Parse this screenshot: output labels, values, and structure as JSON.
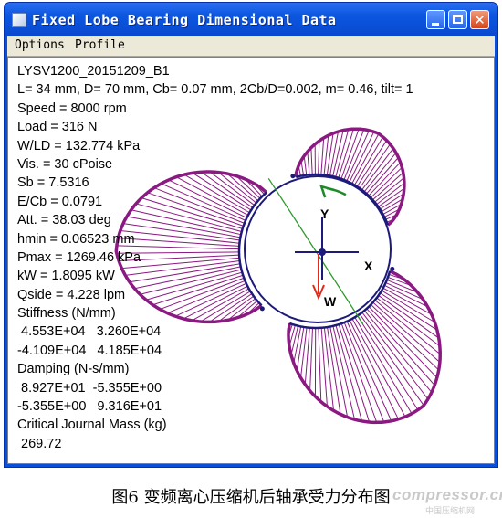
{
  "window": {
    "title": "Fixed Lobe Bearing Dimensional Data",
    "close_glyph": "✕"
  },
  "menu": {
    "options": "Options",
    "profile": "Profile"
  },
  "results": {
    "lines": [
      "LYSV1200_20151209_B1",
      "L= 34 mm, D= 70 mm, Cb= 0.07 mm, 2Cb/D=0.002, m= 0.46, tilt= 1",
      "Speed = 8000 rpm",
      "Load = 316 N",
      "W/LD = 132.774 kPa",
      "Vis. = 30 cPoise",
      "Sb = 7.5316",
      "E/Cb = 0.0791",
      "Att. = 38.03 deg",
      "hmin = 0.06523 mm",
      "Pmax = 1269.46 kPa",
      "kW = 1.8095 kW",
      "Qside = 4.228 lpm",
      "Stiffness (N/mm)",
      " 4.553E+04   3.260E+04",
      "-4.109E+04   4.185E+04",
      "Damping (N-s/mm)",
      " 8.927E+01  -5.355E+00",
      "-5.355E+00   9.316E+01",
      "Critical Journal Mass (kg)",
      " 269.72"
    ]
  },
  "diagram": {
    "axis_y_label": "Y",
    "axis_x_label": "X",
    "load_label": "W",
    "colors": {
      "pressure": "#8a1a82",
      "journal": "#1d1a7a",
      "load_arrow": "#e02a1a",
      "rotation_arrow": "#1e8a2a",
      "line_of_centers": "#2a9a2a"
    }
  },
  "caption": "图6 变频离心压缩机后轴承受力分布图",
  "watermark": "compressor.cn",
  "watermark_sub": "中国压缩机网"
}
